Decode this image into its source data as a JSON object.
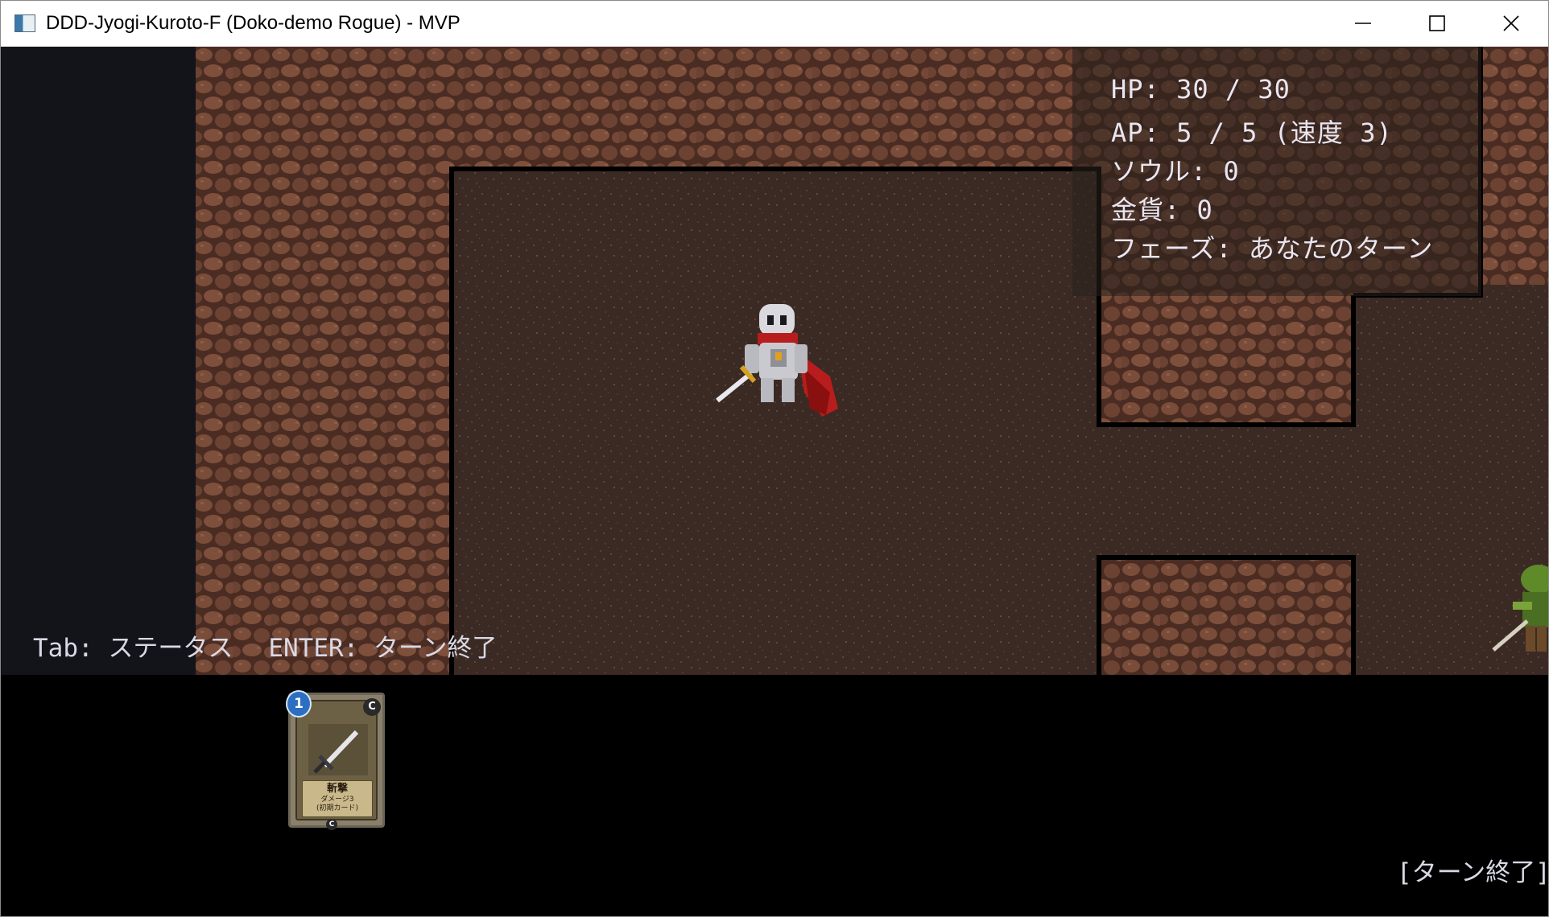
{
  "window": {
    "title": "DDD-Jyogi-Kuroto-F (Doko-demo Rogue) - MVP",
    "app_icon": "window-app-icon",
    "controls": [
      "minimize-icon",
      "maximize-icon",
      "close-icon"
    ]
  },
  "hud": {
    "hp": "HP: 30 / 30",
    "ap": "AP: 5 / 5  (速度 3)",
    "soul": "ソウル: 0",
    "gold": "金貨: 0",
    "phase": "フェーズ: あなたのターン"
  },
  "hints": {
    "tab": "Tab: ステータス",
    "enter": "ENTER: ターン終了"
  },
  "hand": {
    "cards": [
      {
        "cost": "1",
        "rarity": "C",
        "name": "斬撃",
        "description": "ダメージ3",
        "note": "(初期カード)",
        "art_icon": "sword-icon"
      }
    ]
  },
  "end_turn_button": "[ターン終了]",
  "colors": {
    "floor": "#3b2a24",
    "wall": "#6b4332",
    "wall_outline": "#000000",
    "hud_text": "#e9e6f2"
  }
}
